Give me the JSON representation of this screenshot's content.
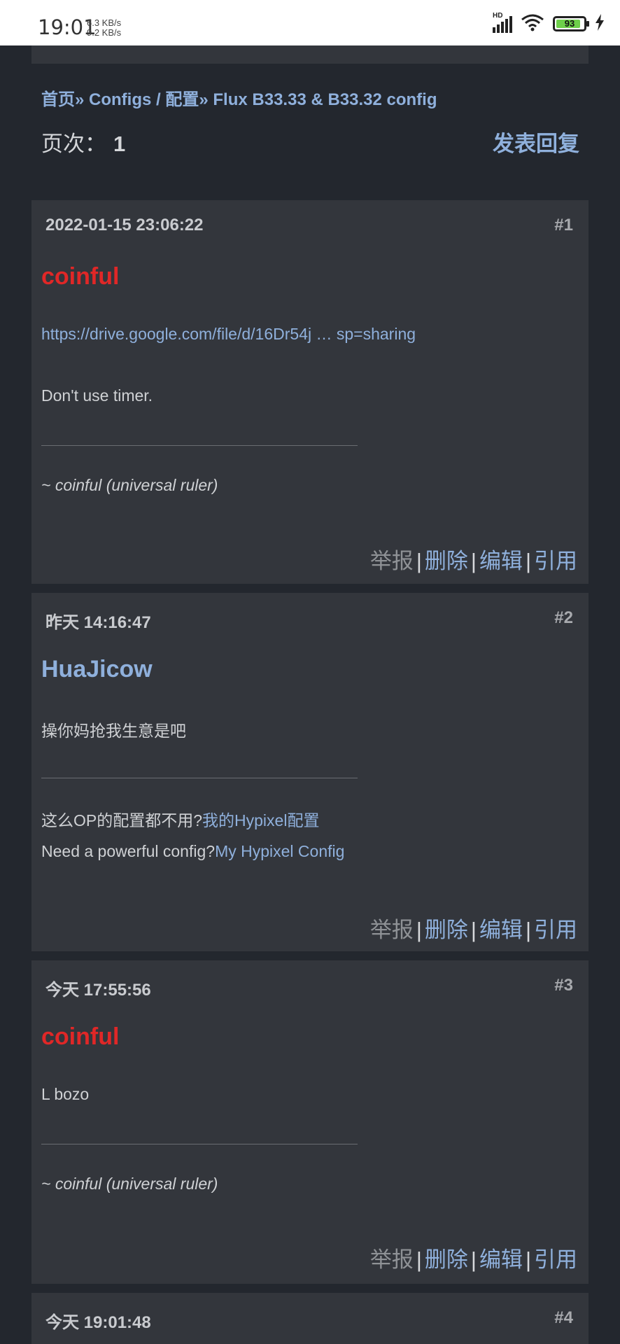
{
  "status": {
    "time": "19:01",
    "net_up": "6.3 KB/s",
    "net_down": "9.2 KB/s",
    "signal_label": "HD",
    "battery": "93"
  },
  "breadcrumb": {
    "home": "首页",
    "sep1": "»",
    "forum": "Configs / 配置",
    "sep2": "»",
    "thread": "Flux B33.33 & B33.32 config"
  },
  "pager": {
    "label": "页次：",
    "page": "1"
  },
  "reply_button": "发表回复",
  "actions": {
    "report": "举报",
    "delete": "删除",
    "edit": "编辑",
    "quote": "引用",
    "sep": "|"
  },
  "posts": [
    {
      "date": "2022-01-15 23:06:22",
      "number": "#1",
      "author": "coinful",
      "link": "https://drive.google.com/file/d/16Dr54j … sp=sharing",
      "body": "Don't use timer.",
      "signature": "~ coinful (universal ruler)"
    },
    {
      "date": "昨天 14:16:47",
      "number": "#2",
      "author": "HuaJicow",
      "body": "操你妈抢我生意是吧",
      "sig_line1_text": "这么OP的配置都不用?",
      "sig_line1_link": "我的Hypixel配置",
      "sig_line2_text": "Need a powerful config?",
      "sig_line2_link": "My Hypixel Config"
    },
    {
      "date": "今天 17:55:56",
      "number": "#3",
      "author": "coinful",
      "body": "L bozo",
      "signature": "~ coinful (universal ruler)"
    },
    {
      "date": "今天 19:01:48",
      "number": "#4"
    }
  ]
}
